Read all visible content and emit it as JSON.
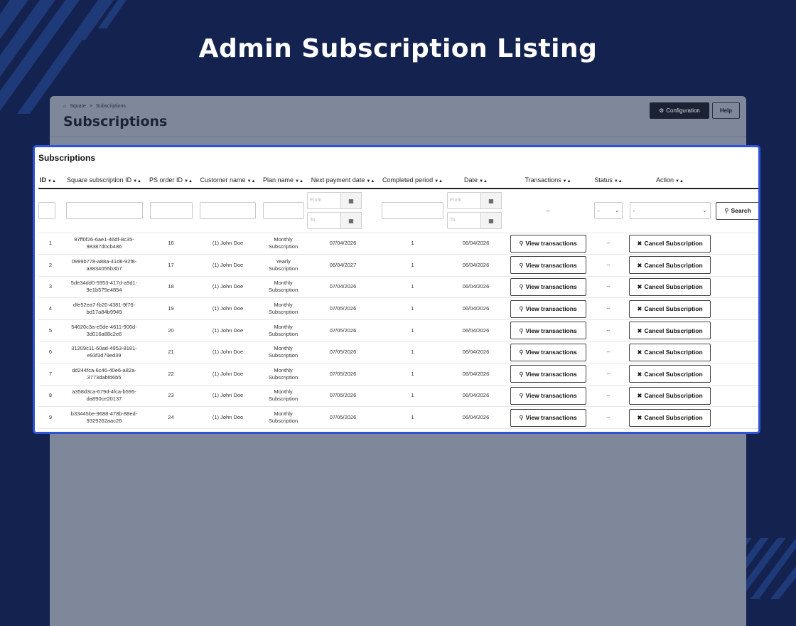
{
  "page_title": "Admin Subscription Listing",
  "background": {
    "breadcrumb": {
      "icon": "store-icon",
      "root": "Square",
      "separator": ">",
      "current": "Subscriptions"
    },
    "heading": "Subscriptions",
    "config_button": {
      "icon": "gears-icon",
      "label": "Configuration"
    },
    "help_button": "Help"
  },
  "card": {
    "title": "Subscriptions",
    "sort_glyph": "▼▲",
    "columns": [
      "ID",
      "Square subscription ID",
      "PS order ID",
      "Customer name",
      "Plan name",
      "Next payment date",
      "Completed period",
      "Date",
      "Transactions",
      "Status",
      "Action"
    ],
    "filters": {
      "date_from_placeholder": "From",
      "date_to_placeholder": "To",
      "transactions_placeholder": "--",
      "status_value": "-",
      "action_value": "-",
      "search_button": "Search"
    },
    "view_label": "View transactions",
    "cancel_label": "Cancel Subscription",
    "rows": [
      {
        "id": "1",
        "sq1": "97ff0f26-6ae1-46df-8c35-",
        "sq2": "98387d0cb486",
        "order": "16",
        "customer": "(1) John Doe",
        "plan1": "Monthly",
        "plan2": "Subscription",
        "next": "07/04/2026",
        "period": "1",
        "date": "06/04/2026",
        "status": "--"
      },
      {
        "id": "2",
        "sq1": "0999b778-a88a-41d6-92f8-",
        "sq2": "a3834055b3b7",
        "order": "17",
        "customer": "(1) John Doe",
        "plan1": "Yearly",
        "plan2": "Subscription",
        "next": "06/04/2027",
        "period": "1",
        "date": "06/04/2026",
        "status": "--"
      },
      {
        "id": "3",
        "sq1": "5de34dd0-5953-417d-a9d1-",
        "sq2": "9e1b575e4854",
        "order": "18",
        "customer": "(1) John Doe",
        "plan1": "Monthly",
        "plan2": "Subscription",
        "next": "07/04/2026",
        "period": "1",
        "date": "06/04/2026",
        "status": "--"
      },
      {
        "id": "4",
        "sq1": "dfe52ea7-fb20-4381-9f76-",
        "sq2": "bd17a84b9949",
        "order": "19",
        "customer": "(1) John Doe",
        "plan1": "Monthly",
        "plan2": "Subscription",
        "next": "07/05/2026",
        "period": "1",
        "date": "06/04/2026",
        "status": "--"
      },
      {
        "id": "5",
        "sq1": "54620c3a-e5de-4611-906d-",
        "sq2": "3d016a88c2e6",
        "order": "20",
        "customer": "(1) John Doe",
        "plan1": "Monthly",
        "plan2": "Subscription",
        "next": "07/05/2026",
        "period": "1",
        "date": "06/04/2026",
        "status": "--"
      },
      {
        "id": "6",
        "sq1": "31209c11-60ad-4953-8181-",
        "sq2": "e93f3d79ed39",
        "order": "21",
        "customer": "(1) John Doe",
        "plan1": "Monthly",
        "plan2": "Subscription",
        "next": "07/05/2026",
        "period": "1",
        "date": "06/04/2026",
        "status": "--"
      },
      {
        "id": "7",
        "sq1": "dd244fca-6c46-40e6-a82a-",
        "sq2": "3773dabfd6b5",
        "order": "22",
        "customer": "(1) John Doe",
        "plan1": "Monthly",
        "plan2": "Subscription",
        "next": "07/05/2026",
        "period": "1",
        "date": "06/04/2026",
        "status": "--"
      },
      {
        "id": "8",
        "sq1": "a358d3ca-679d-4fca-b595-",
        "sq2": "da890ce20137",
        "order": "23",
        "customer": "(1) John Doe",
        "plan1": "Monthly",
        "plan2": "Subscription",
        "next": "07/05/2026",
        "period": "1",
        "date": "06/04/2026",
        "status": "--"
      },
      {
        "id": "9",
        "sq1": "b33445be-9688-478b-88ed-",
        "sq2": "9329262aac26",
        "order": "24",
        "customer": "(1) John Doe",
        "plan1": "Monthly",
        "plan2": "Subscription",
        "next": "07/05/2026",
        "period": "1",
        "date": "06/04/2026",
        "status": "--"
      }
    ]
  },
  "colors": {
    "page_background": "#13224f",
    "highlight_border": "#2f53d8",
    "overlay_panel": "#7f879a",
    "stripe": "#1f3a78"
  }
}
